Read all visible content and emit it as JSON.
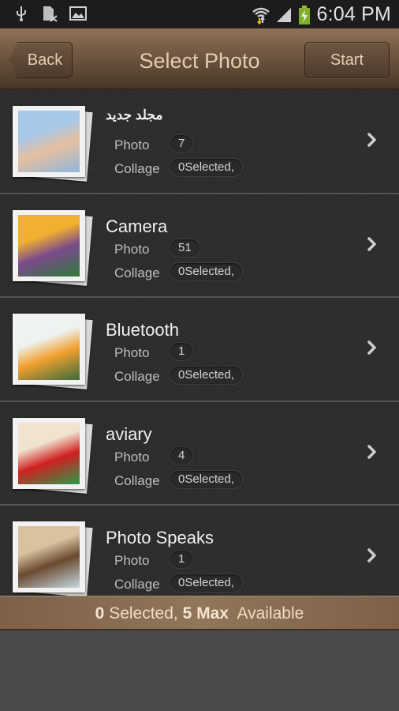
{
  "status_bar": {
    "left_icons": [
      "usb-icon",
      "sim-card-missing-icon",
      "gallery-image-icon"
    ],
    "right_icons": [
      "wifi-icon",
      "signal-icon",
      "battery-charging-icon"
    ],
    "time": "6:04 PM"
  },
  "header": {
    "back_label": "Back",
    "title": "Select Photo",
    "start_label": "Start"
  },
  "albums": [
    {
      "name": "مجلد جديد",
      "photo_label": "Photo",
      "photo_count": "7",
      "collage_label": "Collage",
      "collage_value": "0Selected,",
      "thumb_colors": [
        "#a8c8e8",
        "#e6bfa0",
        "#8fb6dc"
      ]
    },
    {
      "name": "Camera",
      "photo_label": "Photo",
      "photo_count": "51",
      "collage_label": "Collage",
      "collage_value": "0Selected,",
      "thumb_colors": [
        "#f0b030",
        "#7a4a8c",
        "#2f7a3a"
      ]
    },
    {
      "name": "Bluetooth",
      "photo_label": "Photo",
      "photo_count": "1",
      "collage_label": "Collage",
      "collage_value": "0Selected,",
      "thumb_colors": [
        "#eef2f0",
        "#f2a030",
        "#3a6a3a"
      ]
    },
    {
      "name": "aviary",
      "photo_label": "Photo",
      "photo_count": "4",
      "collage_label": "Collage",
      "collage_value": "0Selected,",
      "thumb_colors": [
        "#f0e4d0",
        "#d02020",
        "#2a9a4a"
      ]
    },
    {
      "name": "Photo Speaks",
      "photo_label": "Photo",
      "photo_count": "1",
      "collage_label": "Collage",
      "collage_value": "0Selected,",
      "thumb_colors": [
        "#d8c2a0",
        "#6a4a30",
        "#c8d8e0"
      ]
    }
  ],
  "footer": {
    "selected_count": "0",
    "selected_text": " Selected, ",
    "max_text": "5 Max",
    "available_text": "  Available"
  }
}
